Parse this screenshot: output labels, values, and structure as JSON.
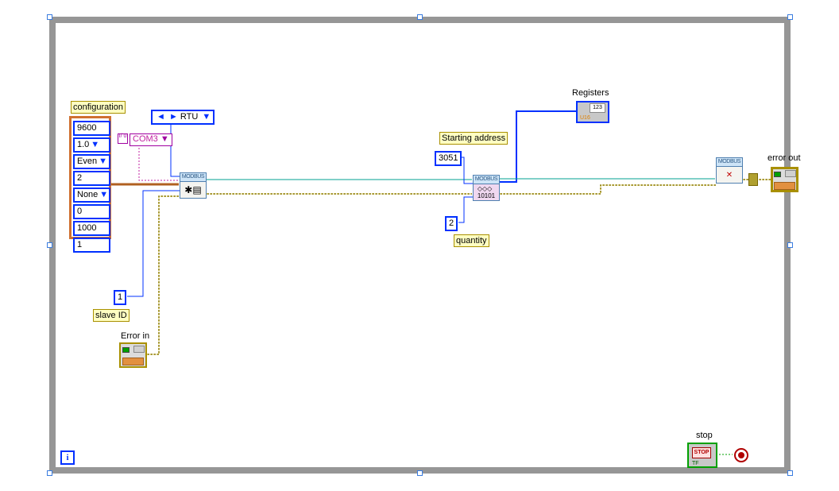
{
  "labels": {
    "configuration": "configuration",
    "slave_id": "slave ID",
    "error_in": "Error in",
    "starting_address": "Starting address",
    "quantity": "quantity",
    "registers": "Registers",
    "stop": "stop",
    "error_out": "error out"
  },
  "inputs": {
    "rtu_mode": "RTU",
    "com_port": "COM3",
    "slave_id_value": "1",
    "starting_address_value": "3051",
    "quantity_value": "2"
  },
  "config_cluster": {
    "baud": "9600",
    "stop_bits": "1.0",
    "parity": "Even",
    "data_bits": "2",
    "flow": "None",
    "rx_timeout": "0",
    "tx_timeout": "1000",
    "poll_delay": "1"
  },
  "nodes": {
    "modbus_label": "MODBUS",
    "registers_display": "123",
    "stop_text": "STOP",
    "tf_text": "TF",
    "iter_glyph": "i",
    "visa_glyph": "I/\n0"
  },
  "arrows": {
    "down": "▼",
    "left": "◄",
    "right": "►"
  }
}
